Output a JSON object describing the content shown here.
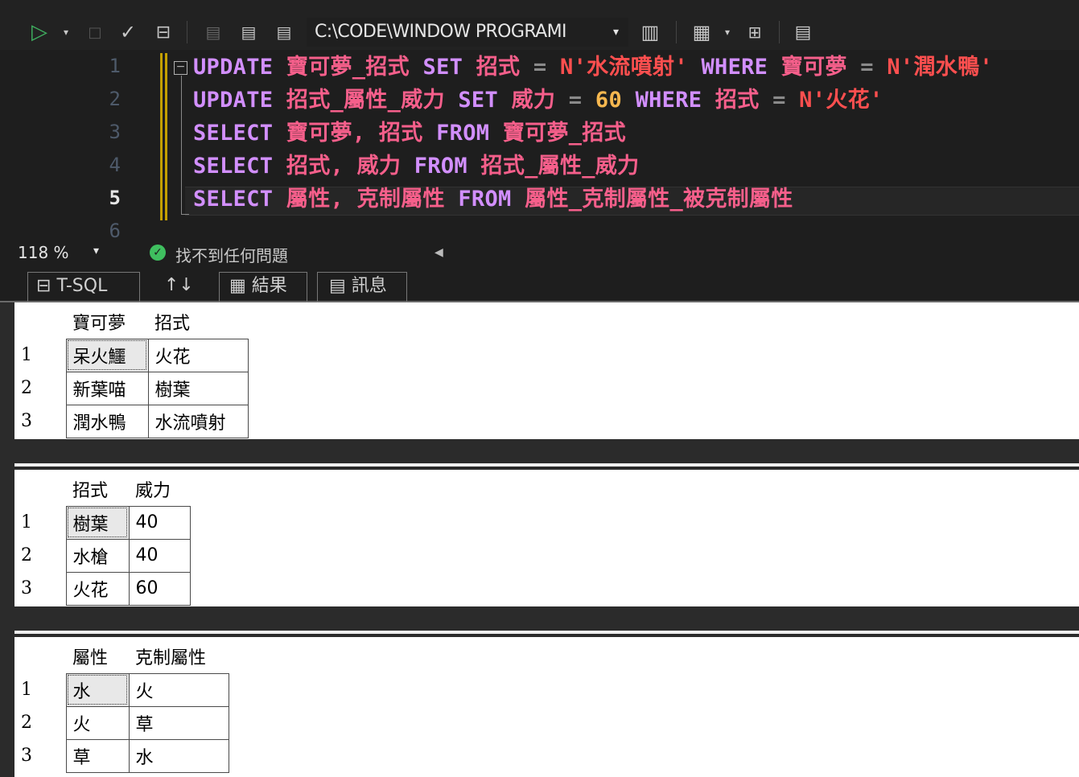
{
  "toolbar": {
    "path": "C:\\CODE\\WINDOW PROGRAMI",
    "icons": [
      "execute-icon",
      "dropdown-icon",
      "stop-icon",
      "parse-check-icon",
      "plan-icon",
      "connect-icon",
      "query-options-icon",
      "results-text-icon",
      "query-file-icon",
      "results-grid-icon",
      "results-dropdown-icon",
      "diagram-icon",
      "comment-icon"
    ]
  },
  "editor": {
    "line_numbers": [
      "1",
      "2",
      "3",
      "4",
      "5",
      "6"
    ],
    "active_line": "5",
    "lines": [
      [
        {
          "t": "UPDATE",
          "c": "kw"
        },
        {
          "t": " 寶可夢_招式 ",
          "c": "id"
        },
        {
          "t": "SET",
          "c": "kw"
        },
        {
          "t": " 招式 ",
          "c": "id"
        },
        {
          "t": "=",
          "c": "op"
        },
        {
          "t": " N'水流噴射' ",
          "c": "str"
        },
        {
          "t": "WHERE",
          "c": "kw"
        },
        {
          "t": " 寶可夢 ",
          "c": "id"
        },
        {
          "t": "=",
          "c": "op"
        },
        {
          "t": " N'潤水鴨'",
          "c": "str"
        }
      ],
      [
        {
          "t": "UPDATE",
          "c": "kw"
        },
        {
          "t": " 招式_屬性_威力 ",
          "c": "id"
        },
        {
          "t": "SET",
          "c": "kw"
        },
        {
          "t": " 威力 ",
          "c": "id"
        },
        {
          "t": "=",
          "c": "op"
        },
        {
          "t": " 60 ",
          "c": "num"
        },
        {
          "t": "WHERE",
          "c": "kw"
        },
        {
          "t": " 招式 ",
          "c": "id"
        },
        {
          "t": "=",
          "c": "op"
        },
        {
          "t": " N'火花'",
          "c": "str"
        }
      ],
      [
        {
          "t": "SELECT",
          "c": "kw"
        },
        {
          "t": " 寶可夢, 招式 ",
          "c": "id"
        },
        {
          "t": "FROM",
          "c": "kw"
        },
        {
          "t": " 寶可夢_招式",
          "c": "id"
        }
      ],
      [
        {
          "t": "SELECT",
          "c": "kw"
        },
        {
          "t": " 招式, 威力 ",
          "c": "id"
        },
        {
          "t": "FROM",
          "c": "kw"
        },
        {
          "t": " 招式_屬性_威力",
          "c": "id"
        }
      ],
      [
        {
          "t": "SELECT",
          "c": "kw"
        },
        {
          "t": " 屬性, 克制屬性 ",
          "c": "id"
        },
        {
          "t": "FROM",
          "c": "kw"
        },
        {
          "t": " 屬性_克制屬性_被克制屬性",
          "c": "id"
        }
      ]
    ]
  },
  "status": {
    "zoom": "118 %",
    "message": "找不到任何問題"
  },
  "tabs": {
    "tsql": "T-SQL",
    "sort": "↑↓",
    "results": "結果",
    "messages": "訊息"
  },
  "results": [
    {
      "columns": [
        "寶可夢",
        "招式"
      ],
      "rows": [
        [
          "1",
          "呆火鱷",
          "火花"
        ],
        [
          "2",
          "新葉喵",
          "樹葉"
        ],
        [
          "3",
          "潤水鴨",
          "水流噴射"
        ]
      ]
    },
    {
      "columns": [
        "招式",
        "威力"
      ],
      "rows": [
        [
          "1",
          "樹葉",
          "40"
        ],
        [
          "2",
          "水槍",
          "40"
        ],
        [
          "3",
          "火花",
          "60"
        ]
      ]
    },
    {
      "columns": [
        "屬性",
        "克制屬性"
      ],
      "rows": [
        [
          "1",
          "水",
          "火"
        ],
        [
          "2",
          "火",
          "草"
        ],
        [
          "3",
          "草",
          "水"
        ]
      ]
    }
  ]
}
